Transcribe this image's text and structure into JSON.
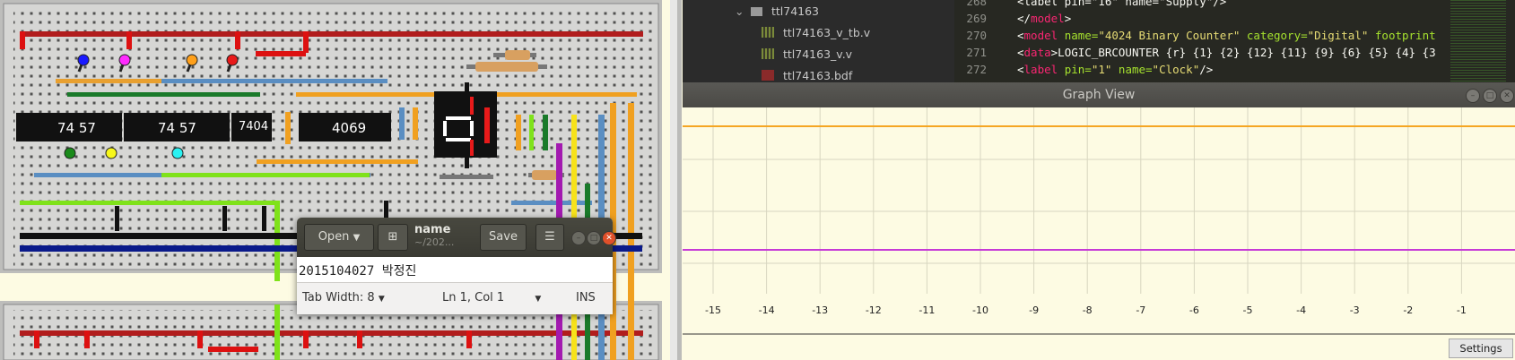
{
  "file_tree": {
    "items": [
      {
        "label": "ttl74163",
        "kind": "folder"
      },
      {
        "label": "ttl74163_v_tb.v",
        "kind": "file"
      },
      {
        "label": "ttl74163_v.v",
        "kind": "file"
      },
      {
        "label": "ttl74163.bdf",
        "kind": "file"
      }
    ]
  },
  "code": {
    "lines": [
      {
        "no": "268",
        "parts": [
          {
            "t": "<label pin=\"16\" name=\"Supply\"/>",
            "c": "plain"
          }
        ]
      },
      {
        "no": "269",
        "parts": [
          {
            "t": "</",
            "c": "plain"
          },
          {
            "t": "model",
            "c": "tag"
          },
          {
            "t": ">",
            "c": "plain"
          }
        ]
      },
      {
        "no": "270",
        "parts": [
          {
            "t": "<",
            "c": "plain"
          },
          {
            "t": "model",
            "c": "tag"
          },
          {
            "t": " name=",
            "c": "attr"
          },
          {
            "t": "\"4024 Binary Counter\"",
            "c": "str"
          },
          {
            "t": " category=",
            "c": "attr"
          },
          {
            "t": "\"Digital\"",
            "c": "str"
          },
          {
            "t": " footprint",
            "c": "attr"
          }
        ]
      },
      {
        "no": "271",
        "parts": [
          {
            "t": "<",
            "c": "plain"
          },
          {
            "t": "data",
            "c": "tag"
          },
          {
            "t": ">LOGIC_BRCOUNTER {r} {1} {2} {12} {11} {9} {6} {5} {4} {3",
            "c": "plain"
          }
        ]
      },
      {
        "no": "272",
        "parts": [
          {
            "t": "<",
            "c": "plain"
          },
          {
            "t": "label",
            "c": "tag"
          },
          {
            "t": " pin=",
            "c": "attr"
          },
          {
            "t": "\"1\"",
            "c": "str"
          },
          {
            "t": " name=",
            "c": "attr"
          },
          {
            "t": "\"Clock\"",
            "c": "str"
          },
          {
            "t": "/>",
            "c": "plain"
          }
        ]
      }
    ]
  },
  "graph_view": {
    "title": "Graph View",
    "x_ticks": [
      "-15",
      "-14",
      "-13",
      "-12",
      "-11",
      "-10",
      "-9",
      "-8",
      "-7",
      "-6",
      "-5",
      "-4",
      "-3",
      "-2",
      "-1"
    ],
    "traces": [
      {
        "color": "#f5a623",
        "level": "high"
      },
      {
        "color": "#c63ad6",
        "level": "low"
      }
    ],
    "settings_label": "Settings"
  },
  "gedit": {
    "open_label": "Open",
    "title": "name",
    "path": "~/202...",
    "save_label": "Save",
    "content": "2015104027 박정진",
    "tab_width": "Tab Width: 8",
    "cursor_pos": "Ln 1, Col 1",
    "mode": "INS"
  },
  "breadboard": {
    "chips": [
      "74 57",
      "74 57",
      "7404",
      "4069"
    ]
  },
  "colors": {
    "board": "#d6d6d4",
    "graph_background": "#fdfbe3",
    "editor_background": "#272822"
  }
}
